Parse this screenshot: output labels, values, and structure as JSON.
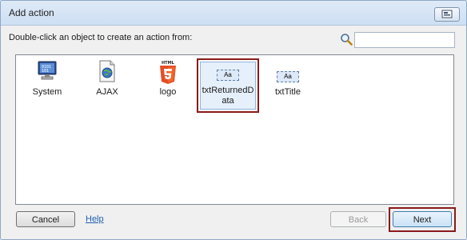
{
  "window": {
    "title": "Add action"
  },
  "instruction": "Double-click an object to create an action from:",
  "search": {
    "placeholder": "",
    "value": ""
  },
  "objects": [
    {
      "label": "System",
      "icon": "system-monitor-icon"
    },
    {
      "label": "AJAX",
      "icon": "ajax-globe-icon"
    },
    {
      "label": "logo",
      "icon": "html5-icon"
    },
    {
      "label_line1": "txtReturnedD",
      "label_line2": "ata",
      "icon_text": "Aa",
      "icon": "textbox-icon",
      "selected": true
    },
    {
      "label": "txtTitle",
      "icon_text": "Aa",
      "icon": "textbox-icon"
    }
  ],
  "buttons": {
    "cancel": "Cancel",
    "help": "Help",
    "back": "Back",
    "next": "Next"
  },
  "colors": {
    "highlight": "#8b1a1a",
    "link": "#1f5eb0"
  }
}
